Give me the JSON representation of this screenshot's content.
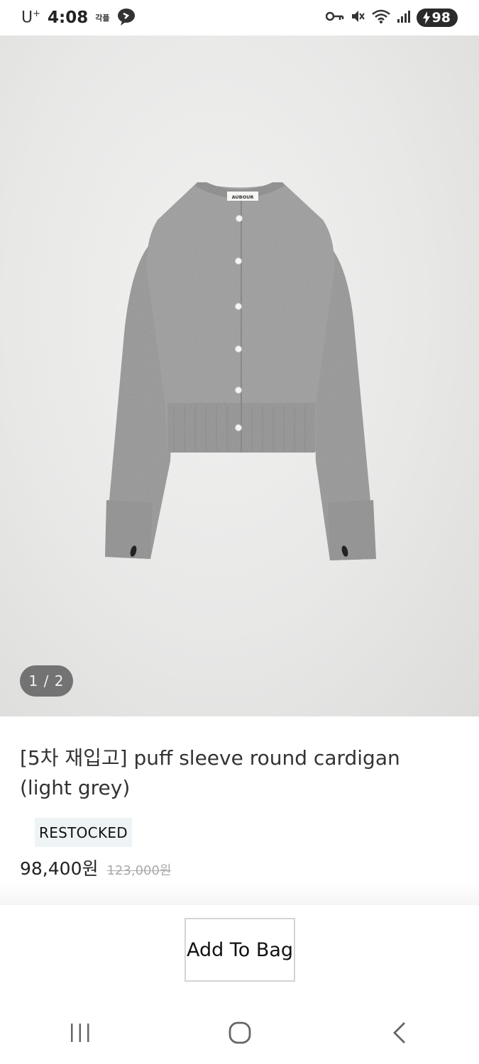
{
  "status_bar": {
    "carrier": "U",
    "carrier_sup": "+",
    "time": "4:08",
    "notif_text": "각플",
    "battery": "98"
  },
  "gallery": {
    "counter": "1 / 2",
    "garment_label": "AUBOUR"
  },
  "product": {
    "title": "[5차 재입고] puff sleeve round cardigan (light grey)",
    "badge": "RESTOCKED",
    "price": "98,400원",
    "original_price": "123,000원"
  },
  "actions": {
    "add_to_bag_label": "Add To Bag"
  },
  "nav": {
    "recent_icon": "recent-apps-icon",
    "home_icon": "home-icon",
    "back_icon": "back-icon"
  },
  "colors": {
    "badge_bg": "#eef4f6",
    "sweater": "#9b9b9b",
    "counter_bg": "#5a5a5a"
  }
}
